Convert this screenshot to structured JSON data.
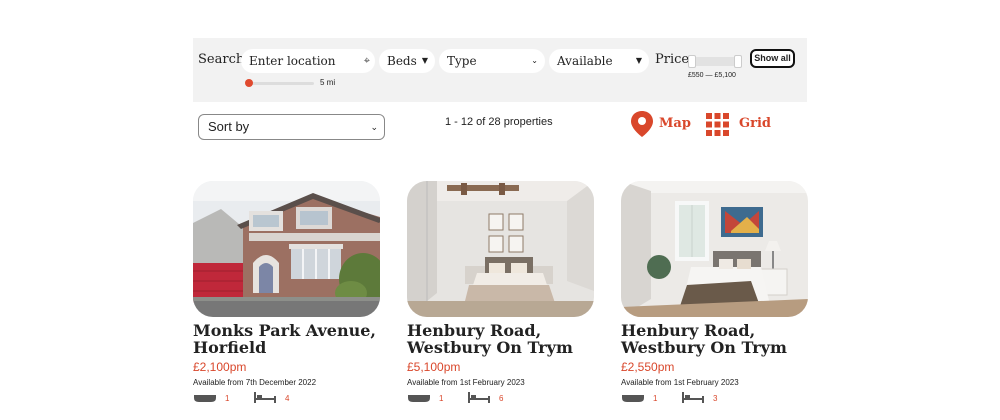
{
  "search": {
    "label": "Search",
    "location_placeholder": "Enter location",
    "radius_value": "5 mi",
    "beds_label": "Beds",
    "type_label": "Type",
    "available_label": "Available",
    "price_label": "Price",
    "price_range": "£550 — £5,100",
    "show_all_label": "Show all"
  },
  "controls": {
    "sort_label": "Sort by",
    "result_count": "1 - 12 of 28 properties",
    "map_label": "Map",
    "grid_label": "Grid"
  },
  "colors": {
    "accent": "#d9472b",
    "panel_bg": "#f2f2f2"
  },
  "listings": [
    {
      "title": "Monks Park Avenue, Horfield",
      "price": "£2,100pm",
      "availability": "Available from 7th December 2022",
      "baths": "1",
      "beds": "4"
    },
    {
      "title": "Henbury Road, Westbury On Trym",
      "price": "£5,100pm",
      "availability": "Available from 1st February 2023",
      "baths": "1",
      "beds": "6"
    },
    {
      "title": "Henbury Road, Westbury On Trym",
      "price": "£2,550pm",
      "availability": "Available from 1st February 2023",
      "baths": "1",
      "beds": "3"
    }
  ]
}
